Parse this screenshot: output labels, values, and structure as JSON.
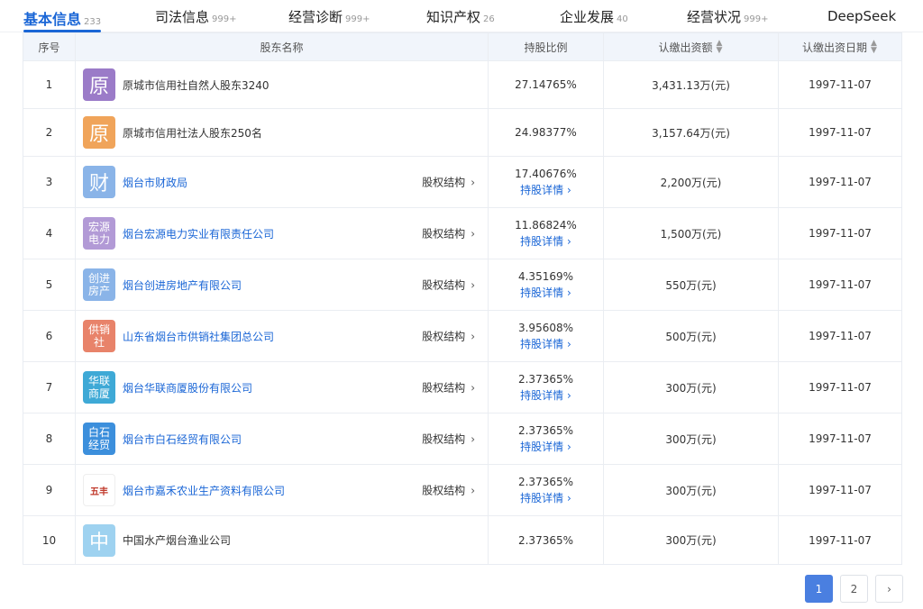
{
  "tabs": [
    {
      "label": "基本信息",
      "count": "233",
      "active": true
    },
    {
      "label": "司法信息",
      "count": "999+"
    },
    {
      "label": "经营诊断",
      "count": "999+"
    },
    {
      "label": "知识产权",
      "count": "26"
    },
    {
      "label": "企业发展",
      "count": "40"
    },
    {
      "label": "经营状况",
      "count": "999+"
    },
    {
      "label": "DeepSeek",
      "count": ""
    }
  ],
  "table": {
    "headers": {
      "index": "序号",
      "name": "股东名称",
      "ratio": "持股比例",
      "amount": "认缴出资额",
      "date": "认缴出资日期"
    },
    "equity_label": "股权结构",
    "detail_label": "持股详情",
    "rows": [
      {
        "index": "1",
        "logo": "原",
        "logo_color": "#9b7bc8",
        "name": "原城市信用社自然人股东3240",
        "ratio": "27.14765%",
        "amount": "3,431.13万(元)",
        "date": "1997-11-07"
      },
      {
        "index": "2",
        "logo": "原",
        "logo_color": "#f0a45a",
        "name": "原城市信用社法人股东250名",
        "ratio": "24.98377%",
        "amount": "3,157.64万(元)",
        "date": "1997-11-07"
      },
      {
        "index": "3",
        "logo": "财",
        "logo_color": "#8ab4e8",
        "name": "烟台市财政局",
        "ratio": "17.40676%",
        "amount": "2,200万(元)",
        "date": "1997-11-07"
      },
      {
        "index": "4",
        "logo": "宏源电力",
        "logo_color": "#b29ad6",
        "name": "烟台宏源电力实业有限责任公司",
        "ratio": "11.86824%",
        "amount": "1,500万(元)",
        "date": "1997-11-07"
      },
      {
        "index": "5",
        "logo": "创进房产",
        "logo_color": "#8ab4e8",
        "name": "烟台创进房地产有限公司",
        "ratio": "4.35169%",
        "amount": "550万(元)",
        "date": "1997-11-07"
      },
      {
        "index": "6",
        "logo": "供销社",
        "logo_color": "#e8836a",
        "name": "山东省烟台市供销社集团总公司",
        "ratio": "3.95608%",
        "amount": "500万(元)",
        "date": "1997-11-07"
      },
      {
        "index": "7",
        "logo": "华联商厦",
        "logo_color": "#3ea9d6",
        "name": "烟台华联商厦股份有限公司",
        "ratio": "2.37365%",
        "amount": "300万(元)",
        "date": "1997-11-07"
      },
      {
        "index": "8",
        "logo": "白石经贸",
        "logo_color": "#3c8fdc",
        "name": "烟台市白石经贸有限公司",
        "ratio": "2.37365%",
        "amount": "300万(元)",
        "date": "1997-11-07"
      },
      {
        "index": "9",
        "logo": "五丰",
        "logo_color": "#ffffff",
        "name": "烟台市嘉禾农业生产资料有限公司",
        "ratio": "2.37365%",
        "amount": "300万(元)",
        "date": "1997-11-07"
      },
      {
        "index": "10",
        "logo": "中",
        "logo_color": "#9ed2f0",
        "name": "中国水产烟台渔业公司",
        "ratio": "2.37365%",
        "amount": "300万(元)",
        "date": "1997-11-07"
      }
    ]
  },
  "pagination": {
    "pages": [
      "1",
      "2"
    ],
    "current": "1",
    "next_icon": "chevron-right-icon"
  }
}
